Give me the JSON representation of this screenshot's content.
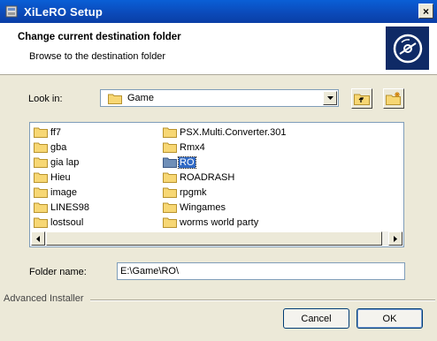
{
  "window": {
    "title": "XiLeRO Setup",
    "close": "×"
  },
  "header": {
    "title": "Change current destination folder",
    "subtitle": "Browse to the destination folder"
  },
  "lookin": {
    "label": "Look in:",
    "value": "Game"
  },
  "folders": {
    "left": [
      "ff7",
      "gba",
      "gia lap",
      "Hieu",
      "image",
      "LINES98",
      "lostsoul"
    ],
    "right": [
      "PSX.Multi.Converter.301",
      "Rmx4",
      "RO",
      "ROADRASH",
      "rpgmk",
      "Wingames",
      "worms world party"
    ],
    "selected": "RO"
  },
  "folder_name": {
    "label": "Folder name:",
    "value": "E:\\Game\\RO\\"
  },
  "footer": {
    "label": "Advanced Installer"
  },
  "buttons": {
    "cancel": "Cancel",
    "ok": "OK"
  },
  "colors": {
    "titlebar": "#0b49b8",
    "selection": "#316ac5",
    "logo_bg": "#0f2a66",
    "dialog_bg": "#ece9d8"
  }
}
